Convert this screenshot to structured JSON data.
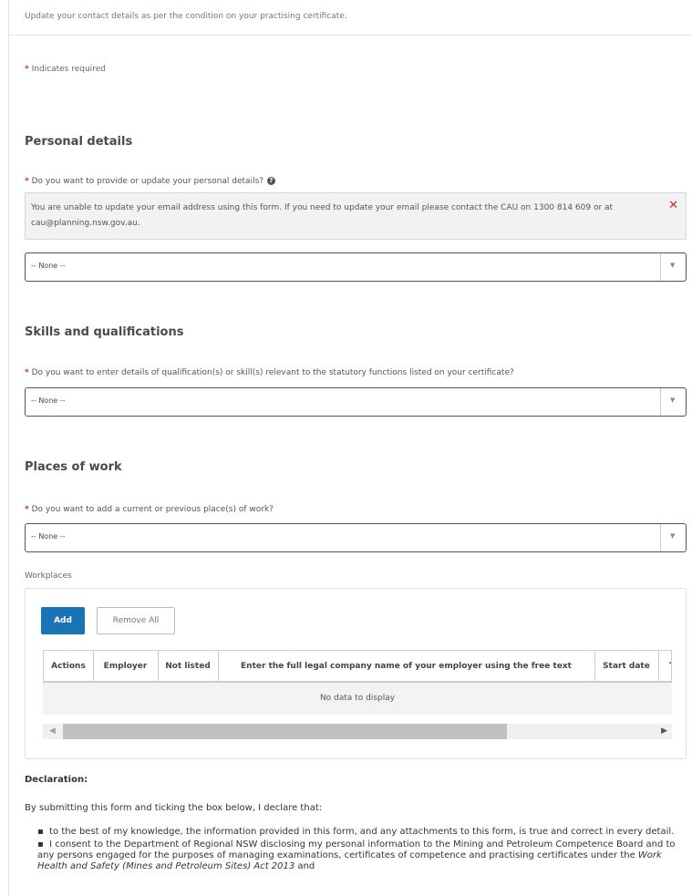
{
  "intro": "Update your contact details as per the condition on your practising certificate.",
  "required_note": {
    "star": "*",
    "text": " Indicates required"
  },
  "personal": {
    "heading": "Personal details",
    "question": "Do you want to provide or update your personal details?",
    "alert": "You are unable to update your email address using this form. If you need to update your email please contact the CAU on 1300 814 609 or at cau@planning.nsw.gov.au.",
    "select_value": "-- None --"
  },
  "skills": {
    "heading": "Skills and qualifications",
    "question": "Do you want to enter details of qualification(s) or skill(s) relevant to the statutory functions listed on your certificate?",
    "select_value": "-- None --"
  },
  "work": {
    "heading": "Places of work",
    "question": "Do you want to add a current or previous place(s) of work?",
    "select_value": "-- None --"
  },
  "workplaces": {
    "label": "Workplaces",
    "add_label": "Add",
    "remove_all_label": "Remove All",
    "columns": [
      "Actions",
      "Employer",
      "Not listed",
      "Enter the full legal company name of your employer using the free text",
      "Start date",
      "T"
    ],
    "empty_text": "No data to display"
  },
  "declaration": {
    "heading": "Declaration:",
    "lead": "By submitting this form and ticking the box below, I declare that:",
    "bullet1": "to the best of my knowledge, the information provided in this form, and any attachments to this form, is true and correct in every detail.",
    "bullet2_a": "I consent to the Department of Regional NSW disclosing my personal information to the Mining and Petroleum Competence Board and to any persons engaged for the purposes of managing examinations, certificates of competence and practising certificates under the ",
    "bullet2_italic": "Work Health and Safety (Mines and Petroleum Sites) Act 2013",
    "bullet2_b": " and"
  },
  "icons": {
    "help": "question-circle-icon",
    "close": "close-icon",
    "dropdown": "caret-down-icon"
  },
  "colors": {
    "required": "#c9302c",
    "primary_button": "#1a73b5"
  }
}
